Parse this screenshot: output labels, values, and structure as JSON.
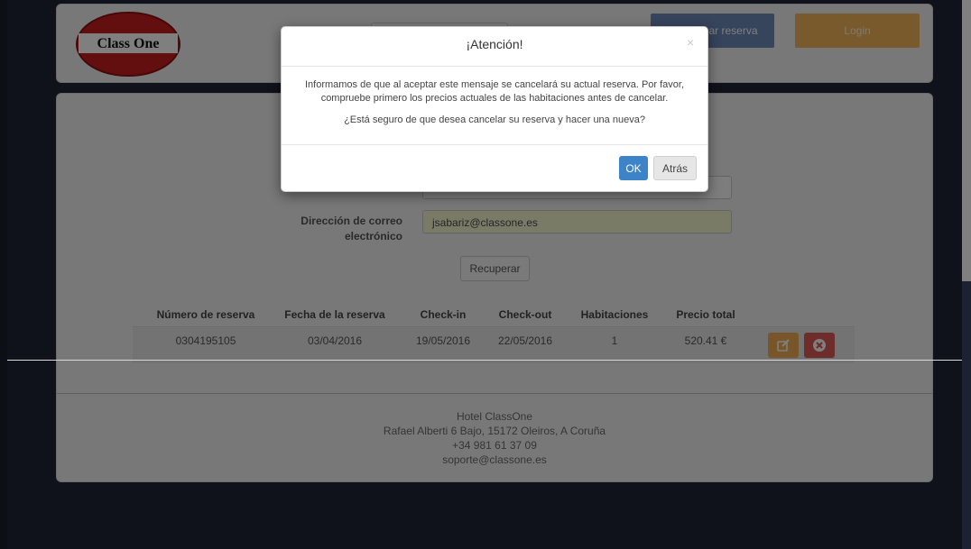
{
  "header": {
    "logo_text": "Class One",
    "reservation_button_label": "ar reserva",
    "login_button_label": "Login"
  },
  "form": {
    "email_label_line1": "Dirección de correo",
    "email_label_line2": "electrónico",
    "email_value": "jsabariz@classone.es",
    "recover_button_label": "Recuperar"
  },
  "table": {
    "headers": [
      "Número de reserva",
      "Fecha de la reserva",
      "Check-in",
      "Check-out",
      "Habitaciones",
      "Precio total"
    ],
    "rows": [
      [
        "0304195105",
        "03/04/2016",
        "19/05/2016",
        "22/05/2016",
        "1",
        "520.41 €"
      ]
    ]
  },
  "footer": {
    "name": "Hotel ClassOne",
    "address": "Rafael Alberti 6 Bajo, 15172 Oleiros, A Coruña",
    "phone": "+34 981 61 37 09",
    "email": "soporte@classone.es"
  },
  "modal": {
    "title": "¡Atención!",
    "close_glyph": "×",
    "message_line1": "Informamos de que al aceptar este mensaje se cancelará su actual reserva. Por favor,",
    "message_line2": "compruebe primero los precios actuales de las habitaciones antes de cancelar.",
    "question": "¿Está seguro de que desea cancelar su reserva y hacer una nueva?",
    "ok_label": "OK",
    "back_label": "Atrás"
  },
  "colors": {
    "modal_ok": "#3c83c7",
    "edit_button": "#f3ac54",
    "delete_button": "#dc5a55",
    "background": "#1f2536"
  }
}
